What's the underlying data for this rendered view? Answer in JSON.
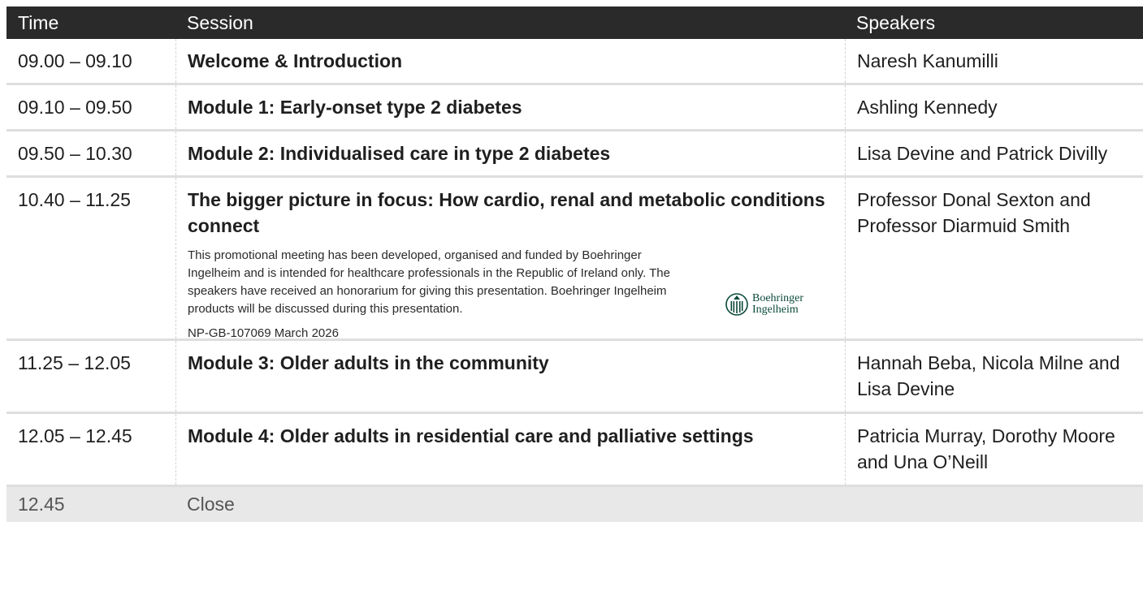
{
  "header": {
    "time": "Time",
    "session": "Session",
    "speakers": "Speakers"
  },
  "rows": [
    {
      "time": "09.00 – 09.10",
      "session": "Welcome & Introduction",
      "speakers": "Naresh Kanumilli"
    },
    {
      "time": "09.10 – 09.50",
      "session": "Module 1: Early-onset type 2 diabetes",
      "speakers": "Ashling Kennedy"
    },
    {
      "time": "09.50 – 10.30",
      "session": "Module 2: Individualised care in type 2 diabetes",
      "speakers": "Lisa Devine and Patrick Divilly"
    },
    {
      "time": "10.40 – 11.25",
      "session": "The bigger picture in focus: How cardio, renal and metabolic conditions connect",
      "speakers": "Professor Donal Sexton and Professor Diarmuid Smith",
      "disclaimer": "This promotional meeting has been developed, organised and funded by Boehringer Ingelheim and is intended for healthcare professionals in the Republic of Ireland only. The speakers have received an honorarium for giving this presentation. Boehringer Ingelheim products will be discussed during this presentation.",
      "code": "NP-GB-107069 March 2026",
      "logo": {
        "line1": "Boehringer",
        "line2": "Ingelheim",
        "icon": "boehringer-ingelheim-logo-icon",
        "color": "#0b4a3a"
      }
    },
    {
      "time": "11.25 – 12.05",
      "session": "Module 3: Older adults in the community",
      "speakers": "Hannah Beba, Nicola Milne and Lisa Devine"
    },
    {
      "time": "12.05 – 12.45",
      "session": "Module 4: Older adults in residential care and palliative settings",
      "speakers": "Patricia Murray, Dorothy Moore and Una O’Neill"
    }
  ],
  "close": {
    "time": "12.45",
    "session": "Close"
  },
  "colors": {
    "header_bg": "#2a2a2a",
    "close_bg": "#e8e8e8",
    "divider": "#dedede"
  }
}
